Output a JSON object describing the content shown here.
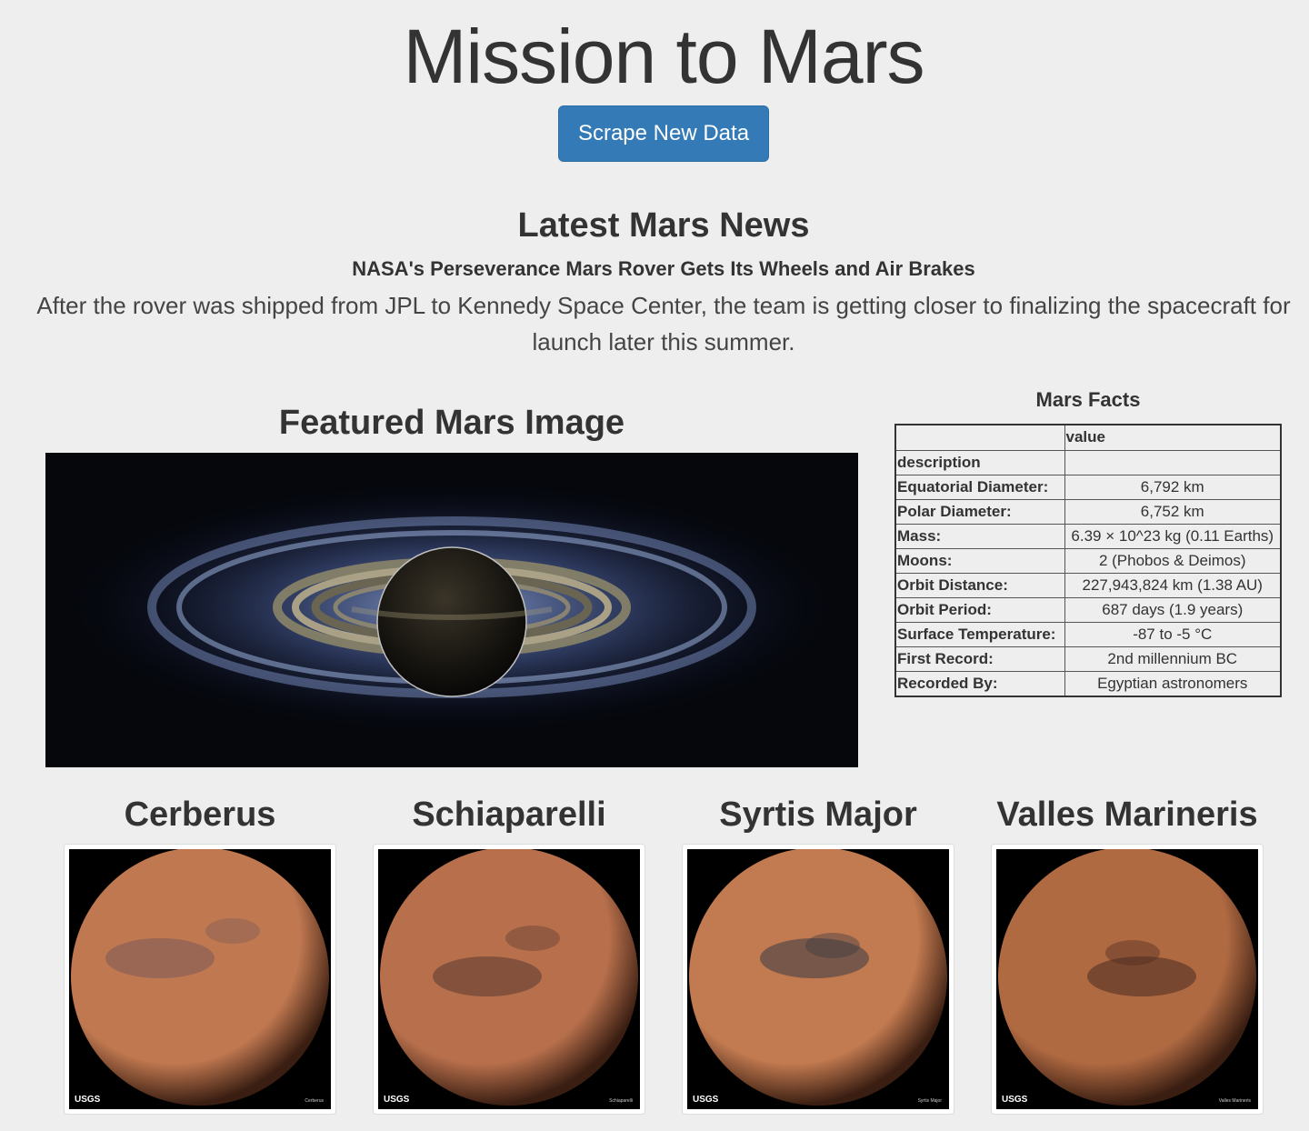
{
  "header": {
    "title": "Mission to Mars",
    "scrape_button_label": "Scrape New Data"
  },
  "news": {
    "heading": "Latest Mars News",
    "title": "NASA's Perseverance Mars Rover Gets Its Wheels and Air Brakes",
    "paragraph": "After the rover was shipped from JPL to Kennedy Space Center, the team is getting closer to finalizing the spacecraft for launch later this summer."
  },
  "featured": {
    "heading": "Featured Mars Image"
  },
  "facts": {
    "heading": "Mars Facts",
    "column_header": "value",
    "index_label": "description",
    "rows": [
      {
        "label": "Equatorial Diameter:",
        "value": "6,792 km"
      },
      {
        "label": "Polar Diameter:",
        "value": "6,752 km"
      },
      {
        "label": "Mass:",
        "value": "6.39 × 10^23 kg (0.11 Earths)"
      },
      {
        "label": "Moons:",
        "value": "2 (Phobos & Deimos)"
      },
      {
        "label": "Orbit Distance:",
        "value": "227,943,824 km (1.38 AU)"
      },
      {
        "label": "Orbit Period:",
        "value": "687 days (1.9 years)"
      },
      {
        "label": "Surface Temperature:",
        "value": "-87 to -5 °C"
      },
      {
        "label": "First Record:",
        "value": "2nd millennium BC"
      },
      {
        "label": "Recorded By:",
        "value": "Egyptian astronomers"
      }
    ]
  },
  "hemispheres": [
    {
      "title": "Cerberus",
      "usgs": "USGS",
      "caption": "Cerberus",
      "base": "#c07850",
      "dark": "#7a5a58"
    },
    {
      "title": "Schiaparelli",
      "usgs": "USGS",
      "caption": "Schiaparelli",
      "base": "#b8704c",
      "dark": "#5a3a30"
    },
    {
      "title": "Syrtis Major",
      "usgs": "USGS",
      "caption": "Syrtis Major",
      "base": "#c27a50",
      "dark": "#3a3a44"
    },
    {
      "title": "Valles Marineris",
      "usgs": "USGS",
      "caption": "Valles Marineris",
      "base": "#b06a42",
      "dark": "#4a2a20"
    }
  ]
}
